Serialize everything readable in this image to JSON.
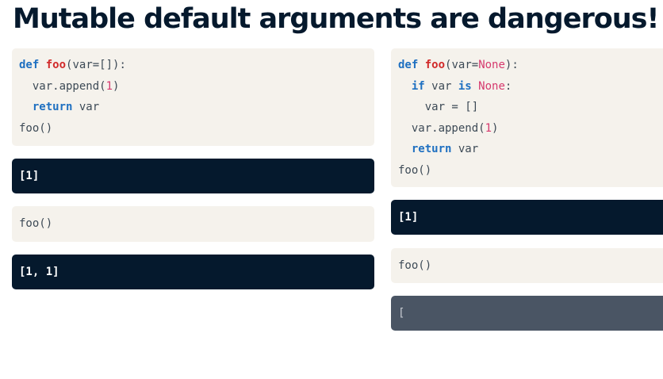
{
  "page": {
    "title": "Mutable default arguments are dangerous!"
  },
  "left": {
    "code1": {
      "l1": {
        "kw": "def",
        "fn": "foo",
        "open": "(var=[]):"
      },
      "l2": {
        "pre": "var.append(",
        "num": "1",
        "post": ")"
      },
      "l3": {
        "kw": "return",
        "rest": " var"
      },
      "l4": {
        "text": "foo()"
      }
    },
    "output1": "[1]",
    "code2": "foo()",
    "output2": "[1, 1]"
  },
  "right": {
    "code1": {
      "l1": {
        "kw": "def",
        "fn": "foo",
        "open": "(var=",
        "const": "None",
        "close": "):"
      },
      "l2": {
        "kw_if": "if",
        "mid": " var ",
        "kw_is": "is",
        "const": "None",
        "close": ":"
      },
      "l3": {
        "text": "var = []"
      },
      "l4": {
        "pre": "var.append(",
        "num": "1",
        "post": ")"
      },
      "l5": {
        "kw": "return",
        "rest": " var"
      },
      "l6": {
        "text": "foo()"
      }
    },
    "output1": "[1]",
    "code2": "foo()",
    "output2_partial": "["
  },
  "colors": {
    "title": "#05192d",
    "code_bg": "#f5f2ec",
    "output_bg": "#05192d",
    "loading_bg": "#4a5564",
    "keyword": "#1f70c1",
    "function": "#d12a2a",
    "number": "#d63a6e"
  }
}
